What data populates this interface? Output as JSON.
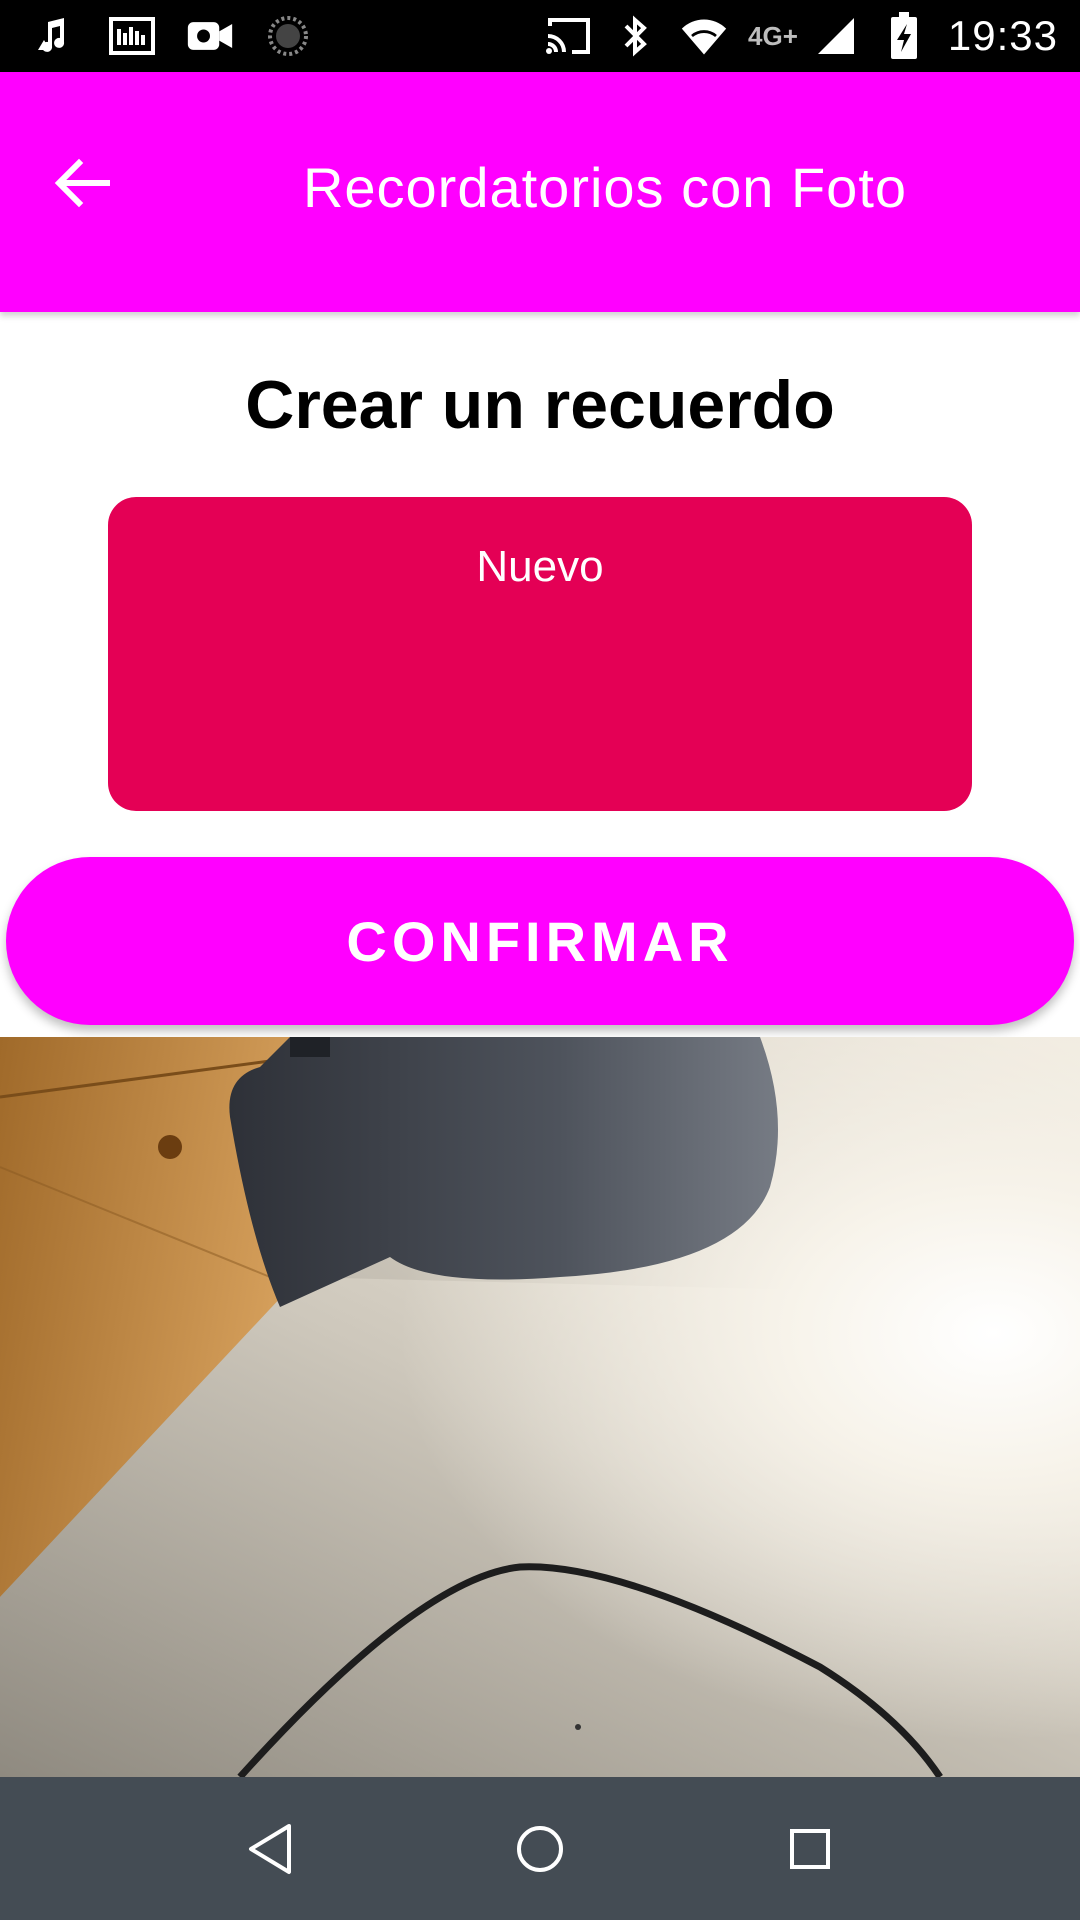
{
  "status_bar": {
    "time": "19:33",
    "network_label": "4G+",
    "left_icons": [
      "music-notification-icon",
      "media-notification-icon",
      "video-camera-icon",
      "loading-circle-icon"
    ],
    "right_icons": [
      "cast-icon",
      "bluetooth-icon",
      "wifi-icon",
      "cell-signal-icon",
      "battery-charging-icon"
    ]
  },
  "app_bar": {
    "title": "Recordatorios con Foto",
    "back_icon": "arrow-back-icon",
    "background": "#ff00ff"
  },
  "main": {
    "heading": "Crear un recuerdo",
    "note_input": {
      "value": "Nuevo",
      "background": "#e40055"
    },
    "confirm_button": {
      "label": "CONFIRMAR",
      "background": "#ff00ff"
    }
  },
  "photo_preview": {
    "icon": "camera-photo"
  },
  "nav_bar": {
    "background": "#444c54",
    "buttons": [
      "back-triangle-icon",
      "home-circle-icon",
      "recents-square-icon"
    ]
  }
}
